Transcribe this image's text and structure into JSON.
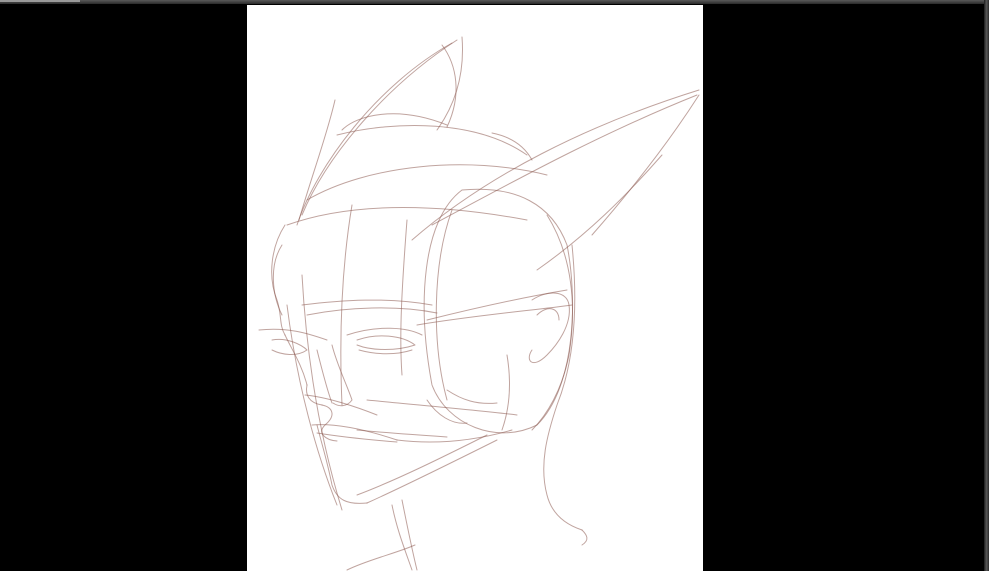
{
  "app": {
    "background_color": "#000000",
    "frame_color": "#4a4a4a"
  },
  "canvas": {
    "paper_color": "#ffffff",
    "stroke_color": "#8c5a50",
    "content": "head-sketch"
  }
}
